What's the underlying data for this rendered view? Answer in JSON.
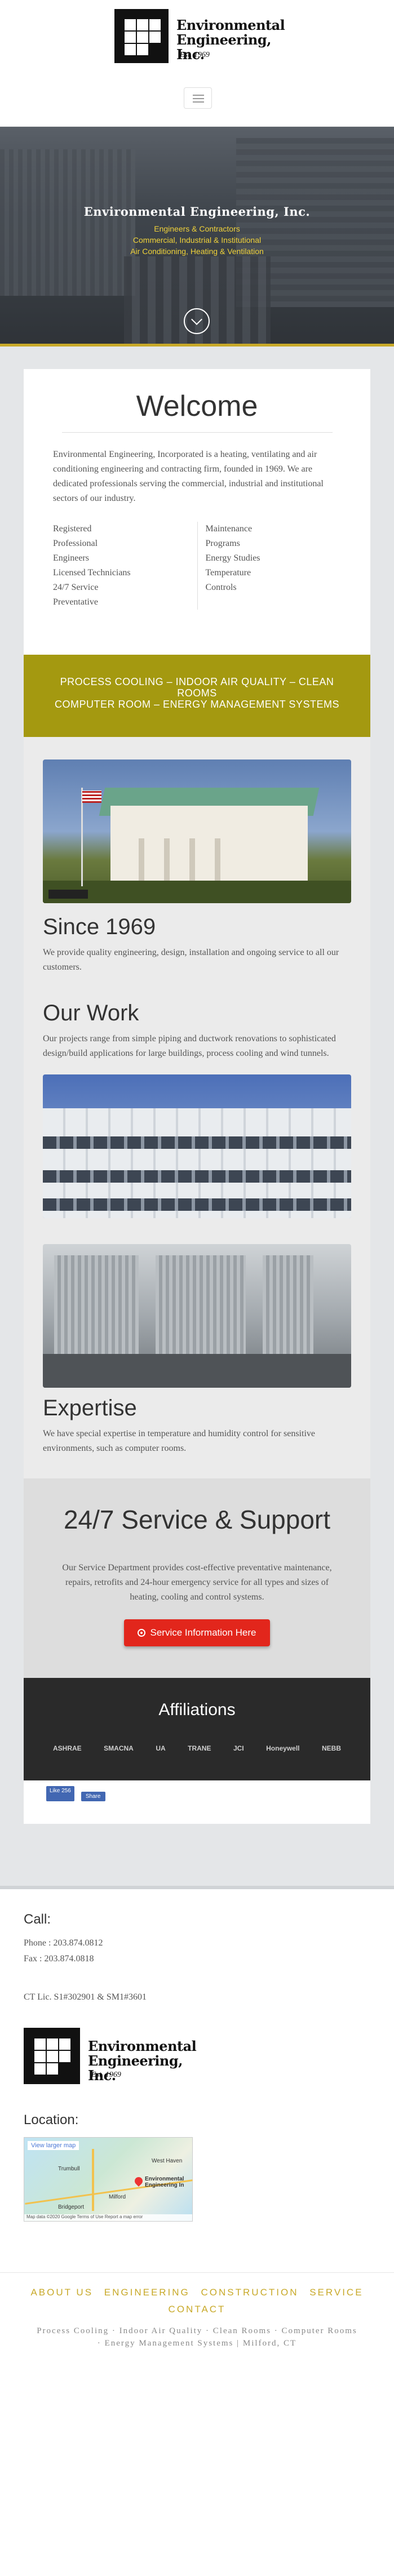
{
  "header": {
    "logo_line1": "Environmental",
    "logo_line2": "Engineering, Inc.",
    "logo_est": "Est. 1969",
    "menu_icon": "hamburger-icon"
  },
  "hero": {
    "title": "Environmental Engineering, Inc.",
    "lines": [
      "Engineers & Contractors",
      "Commercial, Industrial & Institutional",
      "Air Conditioning, Heating & Ventilation"
    ],
    "accent_color": "#c8a928"
  },
  "welcome": {
    "title": "Welcome",
    "body": "Environmental Engineering, Incorporated is a heating, ventilating and air conditioning engineering and contracting firm, founded in 1969. We are dedicated professionals serving the commercial, industrial and institutional sectors of our industry.",
    "left_list": [
      "Registered",
      "Professional",
      "Engineers",
      "Licensed Technicians",
      "24/7 Service",
      "Preventative"
    ],
    "right_list": [
      "Maintenance",
      "Programs",
      "Energy Studies",
      "Temperature",
      "Controls"
    ]
  },
  "banner": {
    "line1": "PROCESS COOLING – INDOOR AIR QUALITY – CLEAN ROOMS",
    "line2": "COMPUTER ROOM – ENERGY MANAGEMENT SYSTEMS",
    "color": "#a49910"
  },
  "since": {
    "title": "Since 1969",
    "text": "We provide quality engineering, design, installation and ongoing service to all our customers."
  },
  "work": {
    "title": "Our Work",
    "text": "Our projects range from simple piping and ductwork renovations to sophisticated design/build applications for large buildings, process cooling and wind tunnels."
  },
  "expertise": {
    "title": "Expertise",
    "text": "We have special expertise in temperature and humidity control for sensitive environments, such as computer rooms."
  },
  "service": {
    "title": "24/7 Service & Support",
    "text": "Our Service Department provides cost-effective preventative maintenance, repairs, retrofits and 24-hour emergency service for all types and sizes of heating, cooling and control systems.",
    "button": "Service Information Here",
    "button_color": "#e2261c"
  },
  "affiliations": {
    "title": "Affiliations",
    "logos": [
      "ASHRAE",
      "SMACNA",
      "UA",
      "TRANE",
      "JCI",
      "Honeywell",
      "NEBB"
    ]
  },
  "social": {
    "like": "Like 256",
    "share": "Share"
  },
  "footer": {
    "call_title": "Call:",
    "phone": "Phone : 203.874.0812",
    "fax": "Fax : 203.874.0818",
    "license": "CT Lic. S1#302901 & SM1#3601",
    "location_title": "Location:",
    "map_link": "View larger map",
    "map_place": "Environmental Engineering In",
    "map_towns": [
      "West Haven",
      "Trumbull",
      "Bridgeport",
      "Milford"
    ],
    "map_footer": "Map data ©2020 Google   Terms of Use   Report a map error",
    "nav": [
      "ABOUT US",
      "ENGINEERING",
      "CONSTRUCTION",
      "SERVICE",
      "CONTACT"
    ],
    "meta_line1": "Process Cooling · Indoor Air Quality · Clean Rooms · Computer Rooms",
    "meta_line2": "· Energy Management Systems | Milford, CT"
  }
}
